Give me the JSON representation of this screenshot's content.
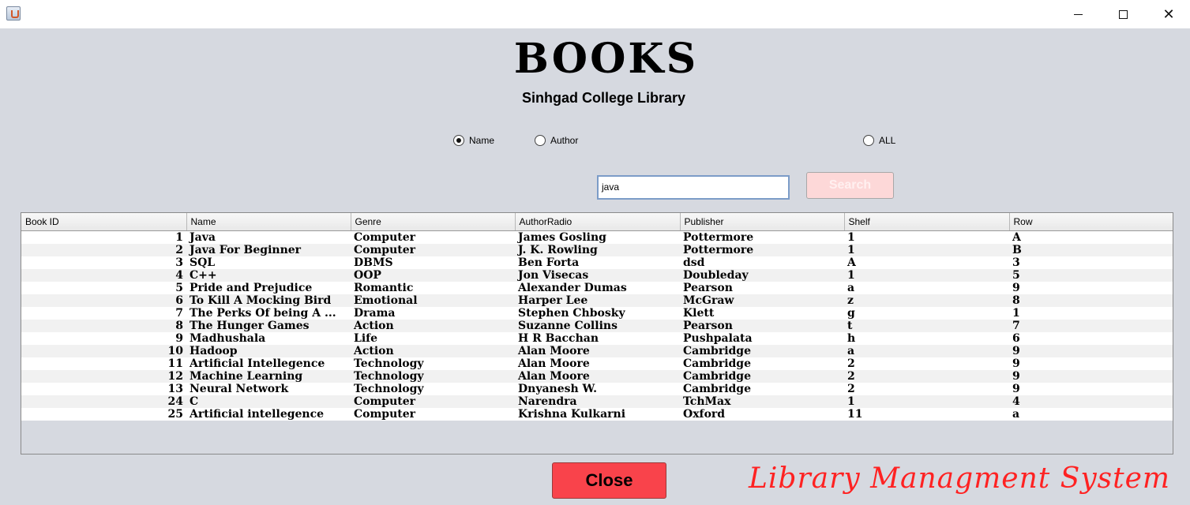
{
  "window": {
    "minimize_glyph": "",
    "close_glyph": "✕"
  },
  "header": {
    "title": "BOOKS",
    "subtitle": "Sinhgad College Library"
  },
  "filters": {
    "options": [
      {
        "label": "Name",
        "selected": true
      },
      {
        "label": "Author",
        "selected": false
      },
      {
        "label": "ALL",
        "selected": false
      }
    ]
  },
  "search": {
    "value": "java",
    "button_label": "Search"
  },
  "table": {
    "columns": [
      "Book ID",
      "Name",
      "Genre",
      "AuthorRadio",
      "Publisher",
      "Shelf",
      "Row"
    ],
    "rows": [
      [
        "1",
        "Java",
        "Computer",
        "James Gosling",
        "Pottermore",
        "1",
        "A"
      ],
      [
        "2",
        "Java For Beginner",
        "Computer",
        "J. K. Rowling",
        "Pottermore",
        "1",
        "B"
      ],
      [
        "3",
        "SQL",
        "DBMS",
        "Ben Forta",
        "dsd",
        "A",
        "3"
      ],
      [
        "4",
        "C++",
        "OOP",
        "Jon Visecas",
        "Doubleday",
        "1",
        "5"
      ],
      [
        "5",
        "Pride and Prejudice",
        "Romantic",
        "Alexander Dumas",
        "Pearson",
        "a",
        "9"
      ],
      [
        "6",
        "To Kill A Mocking Bird",
        "Emotional",
        "Harper Lee",
        "McGraw",
        "z",
        "8"
      ],
      [
        "7",
        "The Perks Of being A ...",
        "Drama",
        "Stephen Chbosky",
        "Klett",
        "g",
        "1"
      ],
      [
        "8",
        "The Hunger Games",
        "Action",
        "Suzanne Collins",
        "Pearson",
        "t",
        "7"
      ],
      [
        "9",
        "Madhushala",
        "Life",
        "H R Bacchan",
        "Pushpalata",
        "h",
        "6"
      ],
      [
        "10",
        "Hadoop",
        "Action",
        "Alan Moore",
        "Cambridge",
        "a",
        "9"
      ],
      [
        "11",
        "Artificial Intellegence",
        "Technology",
        "Alan Moore",
        "Cambridge",
        "2",
        "9"
      ],
      [
        "12",
        "Machine Learning",
        "Technology",
        "Alan Moore",
        "Cambridge",
        "2",
        "9"
      ],
      [
        "13",
        "Neural Network",
        "Technology",
        "Dnyanesh W.",
        "Cambridge",
        "2",
        "9"
      ],
      [
        "24",
        "C",
        "Computer",
        "Narendra",
        "TchMax",
        "1",
        "4"
      ],
      [
        "25",
        "Artificial intellegence",
        "Computer",
        "Krishna Kulkarni",
        "Oxford",
        "11",
        "a"
      ]
    ]
  },
  "footer": {
    "close_label": "Close",
    "brand": "Library Managment System"
  },
  "colors": {
    "background": "#d6d9e0",
    "close_button": "#f9434b",
    "search_button": "#fdd8d8",
    "brand_text": "#ff2222"
  }
}
